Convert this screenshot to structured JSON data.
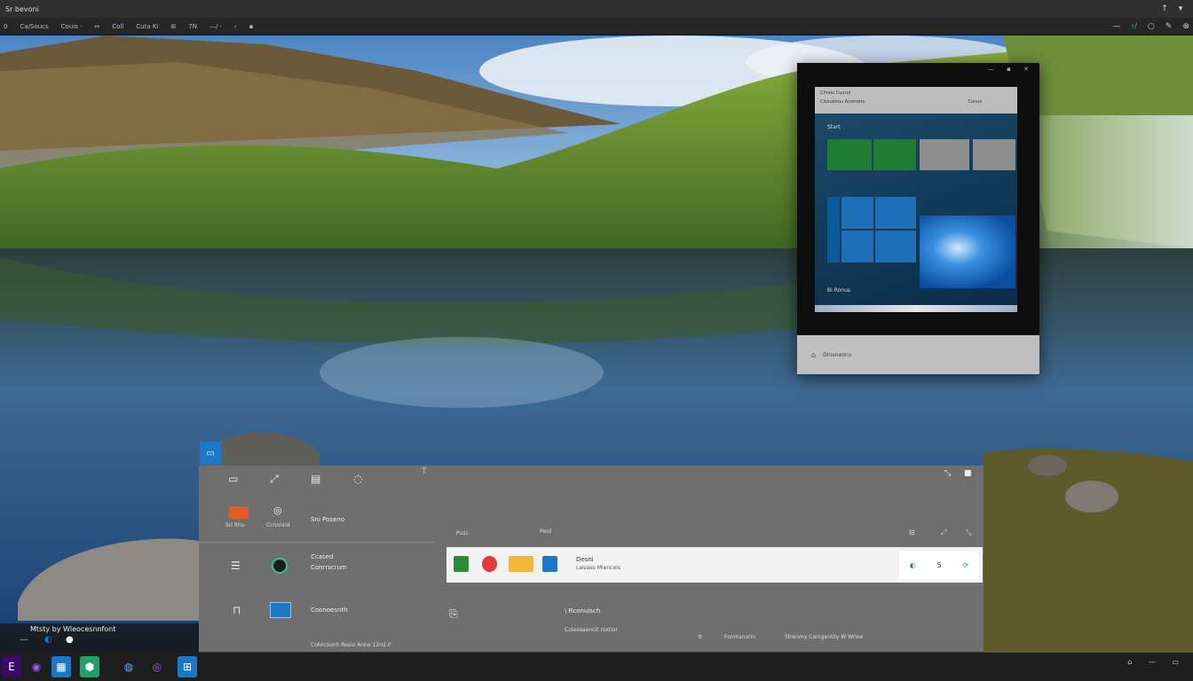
{
  "titlebar": {
    "title": "Sr bevoni",
    "buttons": [
      "↑",
      "▾"
    ]
  },
  "toolbar": {
    "items": [
      "0",
      "Ca/Soucs",
      "Couis ·",
      "↔",
      "Coll",
      "Cuta Ki",
      "⊞",
      "7N",
      "—/ ·",
      "‹",
      "▪"
    ],
    "right_items": [
      "—",
      "‹/",
      "○",
      "✎",
      "⊗"
    ]
  },
  "preview_window": {
    "controls": "— ▪ ✕",
    "header_line1": "Chnou Cuurul",
    "header_line2": "Clvsuonou Anonrets",
    "header_right": "Conus",
    "start_label": "Start",
    "user_label": "Bi Ronus",
    "footer_text": "Dinvneonu"
  },
  "start_panel": {
    "top_icons": [
      "▭",
      "⤢",
      "▤",
      "◌"
    ],
    "pin_glyph": "⊤",
    "window_controls": [
      "⤡",
      "■"
    ],
    "app1_label": "Sri Rhu",
    "app2_label": "Ccnnnnd",
    "app_title": "Sni Poseno",
    "list_item1_title": "Ccased",
    "list_item1_sub": "Conrrscrum",
    "list_item2_title": "Coonoesnth",
    "footer_small": "Cohrcounh Resio Anne 12n2.0",
    "section_left": "Pusc",
    "section_mid": "Pesil",
    "section_right_icons": [
      "⊟",
      "⤢",
      "⤡"
    ],
    "pinned_title": "Desni",
    "pinned_sub": "Lwsaso Mienceis",
    "pinned_right": [
      "◐",
      "5",
      "⟳"
    ],
    "recommended_icon": "⎘",
    "recommended_title": "\\ Rconuisch",
    "recommended_sub": "Coleosaencit roxtior",
    "bottom_right_1": "Fonmsnorin",
    "bottom_right_2": "Strenmy Carcgentiiy W Wrioe"
  },
  "left_notification": {
    "text": "Mtsty by Wleocesnnfont"
  },
  "taskbar": {
    "apps": [
      "E",
      "◉",
      "▦",
      "⬢",
      "◍",
      "◎",
      "⊞"
    ],
    "tray": "⌂ — ▭"
  },
  "colors": {
    "accent": "#1a78c9",
    "panel_bg": "#6f6f6f",
    "taskbar_bg": "#1e1e1e",
    "titlebar_bg": "#303030"
  }
}
